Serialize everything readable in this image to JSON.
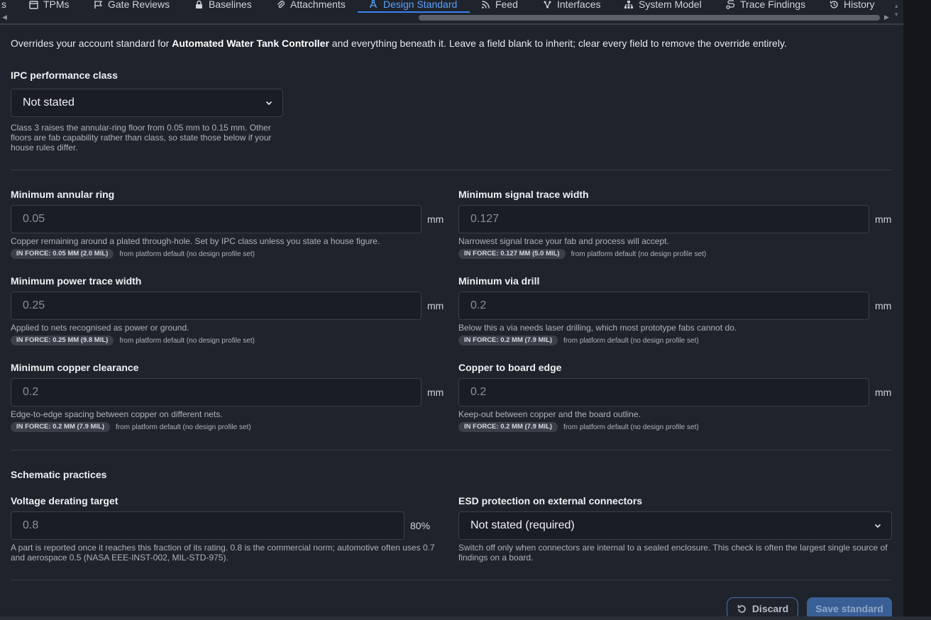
{
  "tabs": [
    {
      "label": "s",
      "icon": "none"
    },
    {
      "label": "TPMs",
      "icon": "calendar-icon"
    },
    {
      "label": "Gate Reviews",
      "icon": "flag-icon"
    },
    {
      "label": "Baselines",
      "icon": "lock-icon"
    },
    {
      "label": "Attachments",
      "icon": "paperclip-icon"
    },
    {
      "label": "Design Standard",
      "icon": "ruler-compass-icon",
      "active": true
    },
    {
      "label": "Feed",
      "icon": "rss-icon"
    },
    {
      "label": "Interfaces",
      "icon": "network-icon"
    },
    {
      "label": "System Model",
      "icon": "hierarchy-icon"
    },
    {
      "label": "Trace Findings",
      "icon": "trace-icon"
    },
    {
      "label": "History",
      "icon": "history-icon"
    }
  ],
  "intro": {
    "prefix": "Overrides your account standard for ",
    "project": "Automated Water Tank Controller",
    "suffix": " and everything beneath it. Leave a field blank to inherit; clear every field to remove the override entirely."
  },
  "ipc": {
    "label": "IPC performance class",
    "value": "Not stated",
    "help": "Class 3 raises the annular-ring floor from 0.05 mm to 0.15 mm. Other floors are fab capability rather than class, so state those below if your house rules differ."
  },
  "fields": [
    {
      "label": "Minimum annular ring",
      "placeholder": "0.05",
      "unit": "mm",
      "help": "Copper remaining around a plated through-hole. Set by IPC class unless you state a house figure.",
      "badge": "IN FORCE: 0.05 MM (2.0 MIL)",
      "source": "from platform default (no design profile set)"
    },
    {
      "label": "Minimum signal trace width",
      "placeholder": "0.127",
      "unit": "mm",
      "help": "Narrowest signal trace your fab and process will accept.",
      "badge": "IN FORCE: 0.127 MM (5.0 MIL)",
      "source": "from platform default (no design profile set)"
    },
    {
      "label": "Minimum power trace width",
      "placeholder": "0.25",
      "unit": "mm",
      "help": "Applied to nets recognised as power or ground.",
      "badge": "IN FORCE: 0.25 MM (9.8 MIL)",
      "source": "from platform default (no design profile set)"
    },
    {
      "label": "Minimum via drill",
      "placeholder": "0.2",
      "unit": "mm",
      "help": "Below this a via needs laser drilling, which most prototype fabs cannot do.",
      "badge": "IN FORCE: 0.2 MM (7.9 MIL)",
      "source": "from platform default (no design profile set)"
    },
    {
      "label": "Minimum copper clearance",
      "placeholder": "0.2",
      "unit": "mm",
      "help": "Edge-to-edge spacing between copper on different nets.",
      "badge": "IN FORCE: 0.2 MM (7.9 MIL)",
      "source": "from platform default (no design profile set)"
    },
    {
      "label": "Copper to board edge",
      "placeholder": "0.2",
      "unit": "mm",
      "help": "Keep-out between copper and the board outline.",
      "badge": "IN FORCE: 0.2 MM (7.9 MIL)",
      "source": "from platform default (no design profile set)"
    }
  ],
  "schematic": {
    "title": "Schematic practices",
    "derating": {
      "label": "Voltage derating target",
      "placeholder": "0.8",
      "unit": "80%",
      "help": "A part is reported once it reaches this fraction of its rating. 0.8 is the commercial norm; automotive often uses 0.7 and aerospace 0.5 (NASA EEE-INST-002, MIL-STD-975)."
    },
    "esd": {
      "label": "ESD protection on external connectors",
      "value": "Not stated (required)",
      "help": "Switch off only when connectors are internal to a sealed enclosure. This check is often the largest single source of findings on a board."
    }
  },
  "actions": {
    "discard": "Discard",
    "save": "Save standard"
  },
  "colors": {
    "accent": "#3b82f6",
    "background": "#1f232b"
  }
}
